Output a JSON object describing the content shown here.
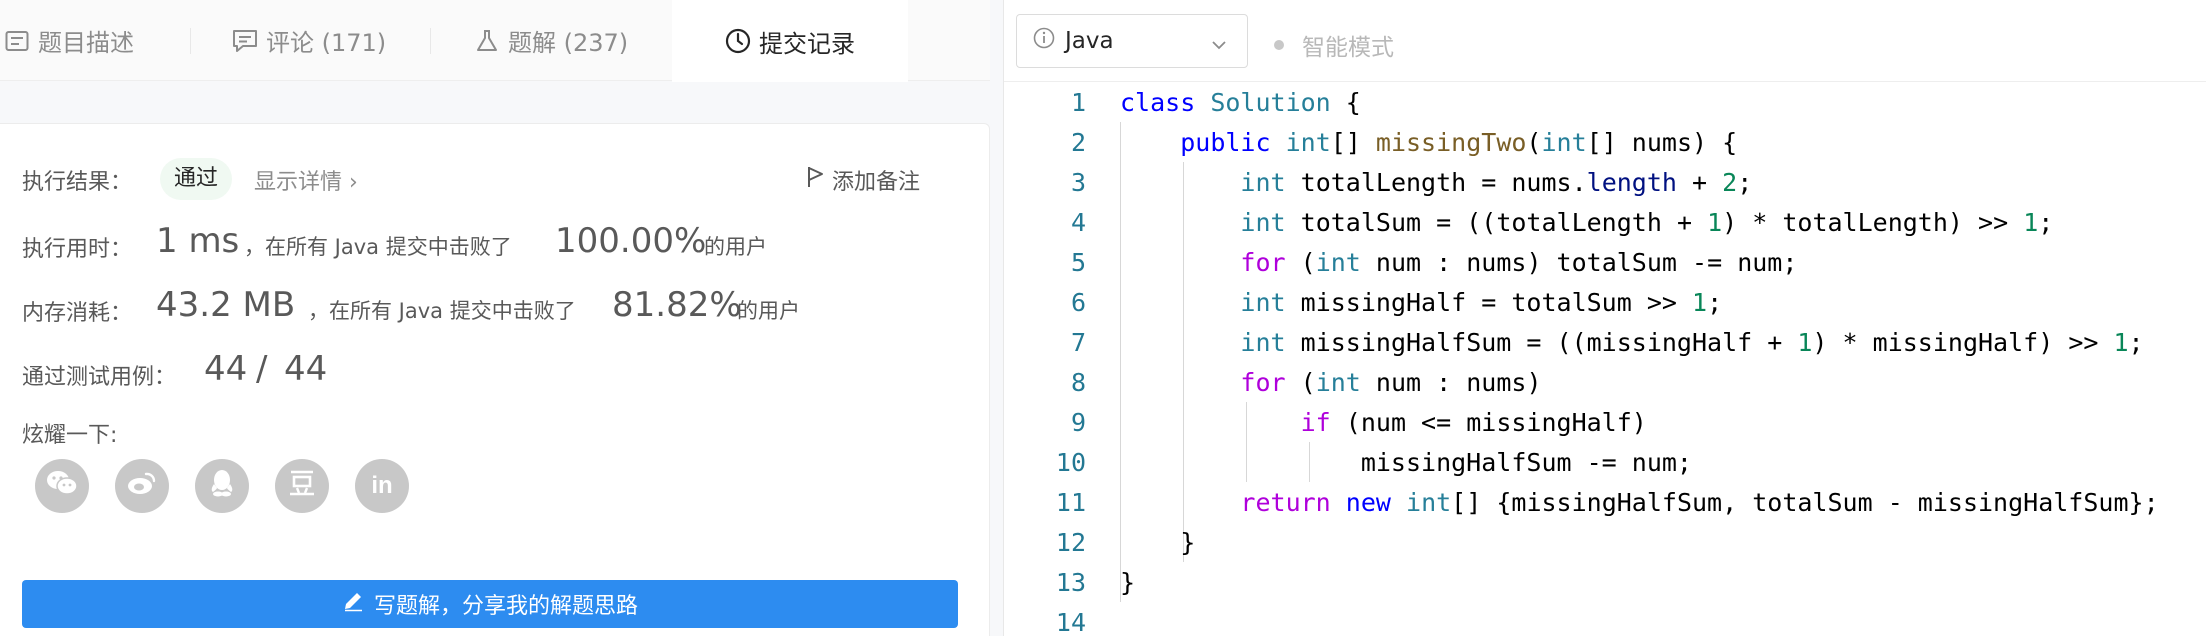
{
  "tabs": [
    {
      "label": "题目描述",
      "icon": "description-icon"
    },
    {
      "label": "评论 (171)",
      "icon": "comment-icon"
    },
    {
      "label": "题解 (237)",
      "icon": "flask-icon"
    },
    {
      "label": "提交记录",
      "icon": "clock-icon",
      "active": true
    }
  ],
  "result": {
    "label": "执行结果：",
    "status": "通过",
    "detail_link": "显示详情 ›",
    "add_note": "添加备注"
  },
  "runtime": {
    "label": "执行用时：",
    "value": "1 ms",
    "middle": "，在所有 Java 提交中击败了",
    "percent": "100.00%",
    "suffix": "的用户"
  },
  "memory": {
    "label": "内存消耗：",
    "value": "43.2 MB",
    "middle": "，在所有 Java 提交中击败了",
    "percent": "81.82%",
    "suffix": "的用户"
  },
  "tests": {
    "label": "通过测试用例：",
    "passed": "44",
    "sep": "/",
    "total": "44"
  },
  "share": {
    "label": "炫耀一下:",
    "targets": [
      "wechat-icon",
      "weibo-icon",
      "qq-icon",
      "douban-icon",
      "linkedin-icon"
    ]
  },
  "write_button": "写题解，分享我的解题思路",
  "editor": {
    "language": "Java",
    "smart_mode": "智能模式",
    "line_numbers": [
      "1",
      "2",
      "3",
      "4",
      "5",
      "6",
      "7",
      "8",
      "9",
      "10",
      "11",
      "12",
      "13",
      "14"
    ],
    "lines": [
      "class Solution {",
      "    public int[] missingTwo(int[] nums) {",
      "        int totalLength = nums.length + 2;",
      "        int totalSum = ((totalLength + 1) * totalLength) >> 1;",
      "        for (int num : nums) totalSum -= num;",
      "        int missingHalf = totalSum >> 1;",
      "        int missingHalfSum = ((missingHalf + 1) * missingHalf) >> 1;",
      "        for (int num : nums)",
      "            if (num <= missingHalf)",
      "                missingHalfSum -= num;",
      "        return new int[] {missingHalfSum, totalSum - missingHalfSum};",
      "    }",
      "}",
      ""
    ]
  },
  "colors": {
    "accent": "#2d8cf0",
    "keyword": "#0000ff",
    "control": "#af00db",
    "type": "#267f99",
    "function": "#795e26",
    "variable": "#001080",
    "number": "#098658",
    "line_number": "#237893"
  }
}
